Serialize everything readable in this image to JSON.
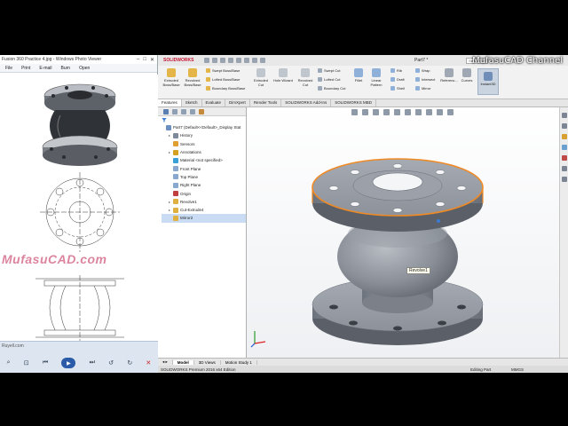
{
  "photo_viewer": {
    "title": "Fusion 360 Practice 4.jpg - Windows Photo Viewer",
    "menu": [
      "File",
      "Print",
      "E-mail",
      "Burn",
      "Open"
    ],
    "watermark": "MufasuCAD.com",
    "overlay_text": "Ruyell.com"
  },
  "solidworks": {
    "logo": "SOLIDWORKS",
    "document_title": "Part7 *",
    "search_placeholder": "Search Co",
    "channel_watermark": "MufasuCAD Channel",
    "ribbon": {
      "extruded_boss": "Extruded Boss/Base",
      "revolved_boss": "Revolved Boss/Base",
      "swept_boss": "Swept Boss/Base",
      "lofted_boss": "Lofted Boss/Base",
      "boundary_boss": "Boundary Boss/Base",
      "extruded_cut": "Extruded Cut",
      "hole_wizard": "Hole Wizard",
      "revolved_cut": "Revolved Cut",
      "swept_cut": "Swept Cut",
      "lofted_cut": "Lofted Cut",
      "boundary_cut": "Boundary Cut",
      "fillet": "Fillet",
      "linear_pattern": "Linear Pattern",
      "rib": "Rib",
      "draft": "Draft",
      "shell": "Shell",
      "wrap": "Wrap",
      "intersect": "Intersect",
      "mirror": "Mirror",
      "reference": "Referenc...",
      "curves": "Curves",
      "instant3d": "Instant3D"
    },
    "command_tabs": [
      "Features",
      "Sketch",
      "Evaluate",
      "DimXpert",
      "Render Tools",
      "SOLIDWORKS Add-Ins",
      "SOLIDWORKS MBD"
    ],
    "feature_tree": [
      {
        "label": "Part7  (Default<<Default>_Display Stat",
        "toggle": "",
        "color": "#6a8fc0"
      },
      {
        "label": "History",
        "toggle": "▸",
        "color": "#7d8a99"
      },
      {
        "label": "Sensors",
        "toggle": "",
        "color": "#e0a030"
      },
      {
        "label": "Annotations",
        "toggle": "▸",
        "color": "#d4a020"
      },
      {
        "label": "Material <not specified>",
        "toggle": "",
        "color": "#3aa0d8"
      },
      {
        "label": "Front Plane",
        "toggle": "",
        "color": "#88a8d0"
      },
      {
        "label": "Top Plane",
        "toggle": "",
        "color": "#88a8d0"
      },
      {
        "label": "Right Plane",
        "toggle": "",
        "color": "#88a8d0"
      },
      {
        "label": "Origin",
        "toggle": "",
        "color": "#c04040"
      },
      {
        "label": "Revolve1",
        "toggle": "▸",
        "color": "#e0b040"
      },
      {
        "label": "Cut-Extrude4",
        "toggle": "▸",
        "color": "#e0b040"
      },
      {
        "label": "Mirror2",
        "toggle": "",
        "color": "#e0b040"
      }
    ],
    "tooltip": "Revolve1",
    "model_tabs": [
      "Model",
      "3D Views",
      "Motion Study 1"
    ],
    "status": {
      "edition": "SOLIDWORKS Premium 2016 x64 Edition",
      "mode": "Editing Part",
      "units": "MMGS"
    }
  },
  "colors": {
    "solidworks_red": "#c41230",
    "selected_edge": "#f08a24",
    "part_body": "#8e939c"
  }
}
